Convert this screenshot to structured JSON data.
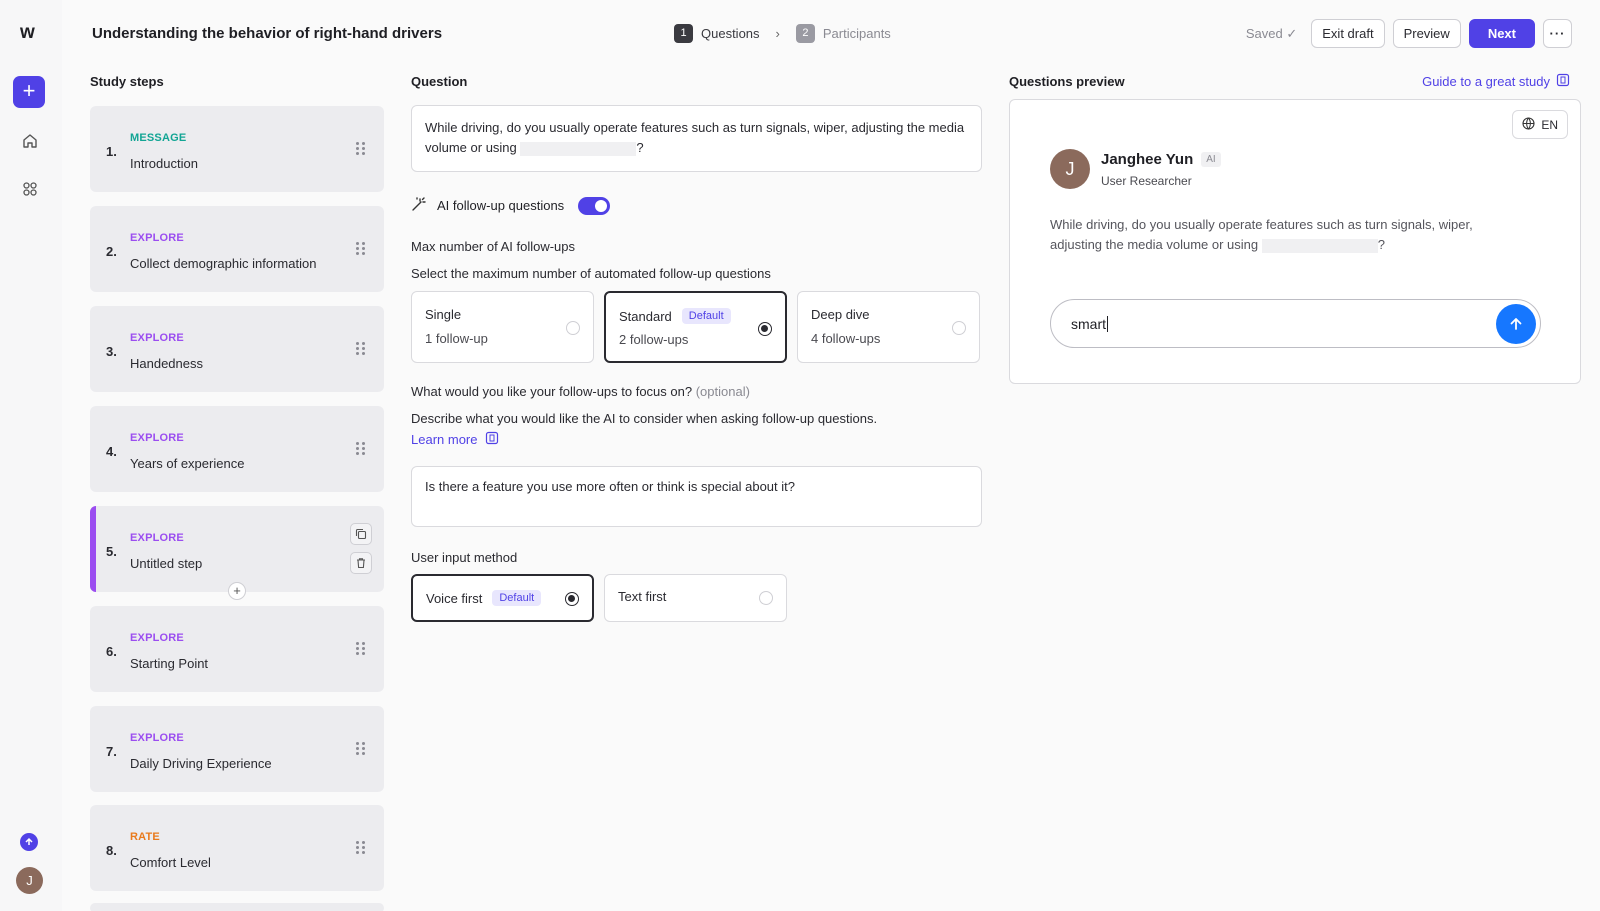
{
  "app": {
    "logo": "w"
  },
  "header": {
    "title": "Understanding the behavior of right-hand drivers",
    "steps": [
      {
        "num": "1",
        "label": "Questions"
      },
      {
        "num": "2",
        "label": "Participants"
      }
    ],
    "saved": "Saved ✓",
    "exit_draft": "Exit draft",
    "preview": "Preview",
    "next": "Next",
    "more": "···"
  },
  "rail": {
    "add": "+",
    "avatar_initial": "J"
  },
  "study_steps": {
    "title": "Study steps",
    "items": [
      {
        "num": "1.",
        "type": "MESSAGE",
        "name": "Introduction"
      },
      {
        "num": "2.",
        "type": "EXPLORE",
        "name": "Collect demographic information"
      },
      {
        "num": "3.",
        "type": "EXPLORE",
        "name": "Handedness"
      },
      {
        "num": "4.",
        "type": "EXPLORE",
        "name": "Years of experience"
      },
      {
        "num": "5.",
        "type": "EXPLORE",
        "name": "Untitled step"
      },
      {
        "num": "6.",
        "type": "EXPLORE",
        "name": "Starting Point"
      },
      {
        "num": "7.",
        "type": "EXPLORE",
        "name": "Daily Driving Experience"
      },
      {
        "num": "8.",
        "type": "RATE",
        "name": "Comfort Level"
      }
    ],
    "add_between": "+"
  },
  "question": {
    "title": "Question",
    "text_before": "While driving, do you usually operate features such as turn signals, wiper, adjusting the media volume or using ",
    "text_after": "?",
    "ai_followup_label": "AI follow-up questions",
    "ai_followup_enabled": true,
    "max_label": "Max number of AI follow-ups",
    "max_sub": "Select the maximum number of automated follow-up questions",
    "followup_options": [
      {
        "title": "Single",
        "badge": "",
        "sub": "1 follow-up",
        "selected": false
      },
      {
        "title": "Standard",
        "badge": "Default",
        "sub": "2 follow-ups",
        "selected": true
      },
      {
        "title": "Deep dive",
        "badge": "",
        "sub": "4 follow-ups",
        "selected": false
      }
    ],
    "focus_label": "What would you like your follow-ups to focus on?",
    "focus_optional": "(optional)",
    "focus_sub": "Describe what you would like the AI to consider when asking follow-up questions.",
    "learn_more": "Learn more",
    "focus_value": "Is there a feature you use more often or think is special about it?",
    "input_method_label": "User input method",
    "input_options": [
      {
        "title": "Voice first",
        "badge": "Default",
        "selected": true
      },
      {
        "title": "Text first",
        "badge": "",
        "selected": false
      }
    ]
  },
  "preview": {
    "title": "Questions preview",
    "guide": "Guide to a great study",
    "lang": "EN",
    "avatar_initial": "J",
    "name": "Janghee Yun",
    "ai_tag": "AI",
    "role": "User Researcher",
    "question_before": "While driving, do you usually operate features such as turn signals, wiper, adjusting the media volume or using ",
    "question_after": "?",
    "input_value": "smart"
  },
  "colors": {
    "accent": "#5041e6",
    "message": "#12a594",
    "explore": "#9b4df0",
    "rate": "#e97a1c",
    "send": "#1677ff"
  }
}
